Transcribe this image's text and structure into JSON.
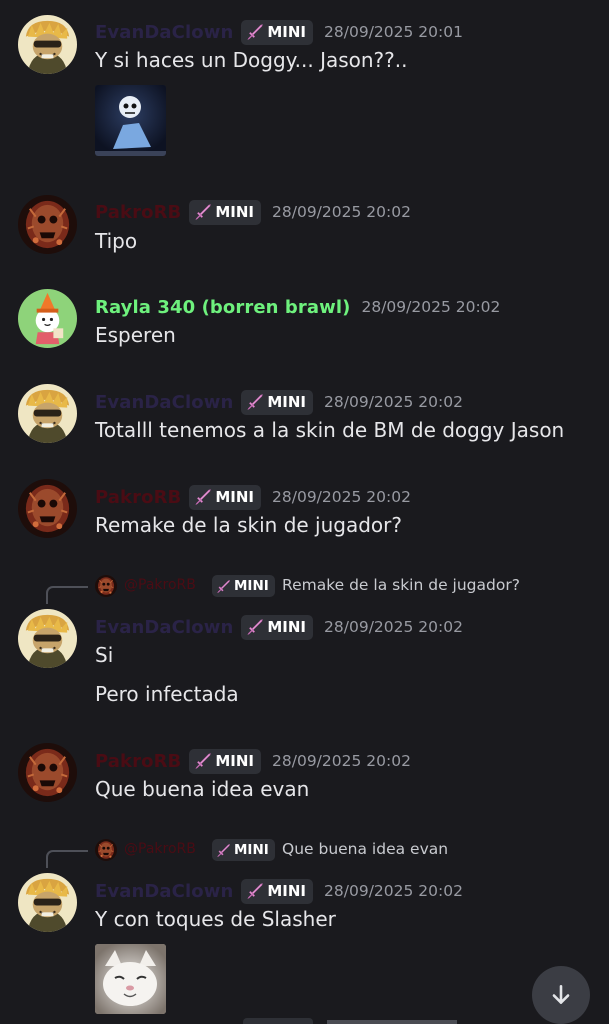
{
  "messages": [
    {
      "author": "EvanDaClown",
      "tag": "MINI",
      "time": "28/09/2025 20:01",
      "lines": [
        "Y si haces un Doggy... Jason??.."
      ]
    },
    {
      "author": "PakroRB",
      "tag": "MINI",
      "time": "28/09/2025 20:02",
      "lines": [
        "Tipo"
      ]
    },
    {
      "author": "Rayla 340 (borren brawl)",
      "time": "28/09/2025 20:02",
      "lines": [
        "Esperen"
      ]
    },
    {
      "author": "EvanDaClown",
      "tag": "MINI",
      "time": "28/09/2025 20:02",
      "lines": [
        "Totalll tenemos a la skin de BM de doggy Jason"
      ]
    },
    {
      "author": "PakroRB",
      "tag": "MINI",
      "time": "28/09/2025 20:02",
      "lines": [
        "Remake de la skin de jugador?"
      ]
    },
    {
      "reply": {
        "author": "@PakroRB",
        "tag": "MINI",
        "text": "Remake de la skin de jugador?"
      },
      "author": "EvanDaClown",
      "tag": "MINI",
      "time": "28/09/2025 20:02",
      "lines": [
        "Si",
        "Pero infectada"
      ]
    },
    {
      "author": "PakroRB",
      "tag": "MINI",
      "time": "28/09/2025 20:02",
      "lines": [
        "Que buena idea evan"
      ]
    },
    {
      "reply": {
        "author": "@PakroRB",
        "tag": "MINI",
        "text": "Que buena idea evan"
      },
      "author": "EvanDaClown",
      "tag": "MINI",
      "time": "28/09/2025 20:02",
      "lines": [
        "Y con toques de Slasher"
      ]
    }
  ],
  "icons": {
    "tag_icon": "sword-icon",
    "scroll_button": "arrow-down-icon"
  },
  "colors": {
    "background": "#1a1a1e",
    "rayla_name": "#6ef17d",
    "evan_name": "#2a2347",
    "pakro_name": "#4a0c14",
    "tag_bg": "#2e3036",
    "timestamp": "#989aa2"
  }
}
